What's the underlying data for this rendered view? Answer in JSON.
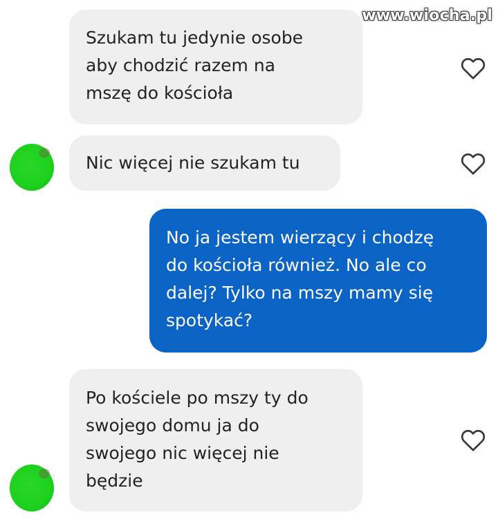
{
  "watermark": "www.wiocha.pl",
  "colors": {
    "received_bubble": "#efefef",
    "sent_bubble": "#0b63c6",
    "avatar": "#1dd11d"
  },
  "messages": [
    {
      "sender": "other",
      "text": "Szukam tu jedynie osobe\naby chodzić razem na\nmszę do kościoła",
      "liked_icon": "heart-outline-icon"
    },
    {
      "sender": "other",
      "text": "Nic więcej nie szukam tu",
      "liked_icon": "heart-outline-icon"
    },
    {
      "sender": "me",
      "text": "No ja jestem wierzący i chodzę\ndo kościoła również. No ale co\ndalej?  Tylko na mszy mamy się\nspotykać?"
    },
    {
      "sender": "other",
      "text": "Po kościele po mszy ty do\nswojego domu ja do\nswojego nic więcej nie\nbędzie",
      "liked_icon": "heart-outline-icon"
    }
  ]
}
